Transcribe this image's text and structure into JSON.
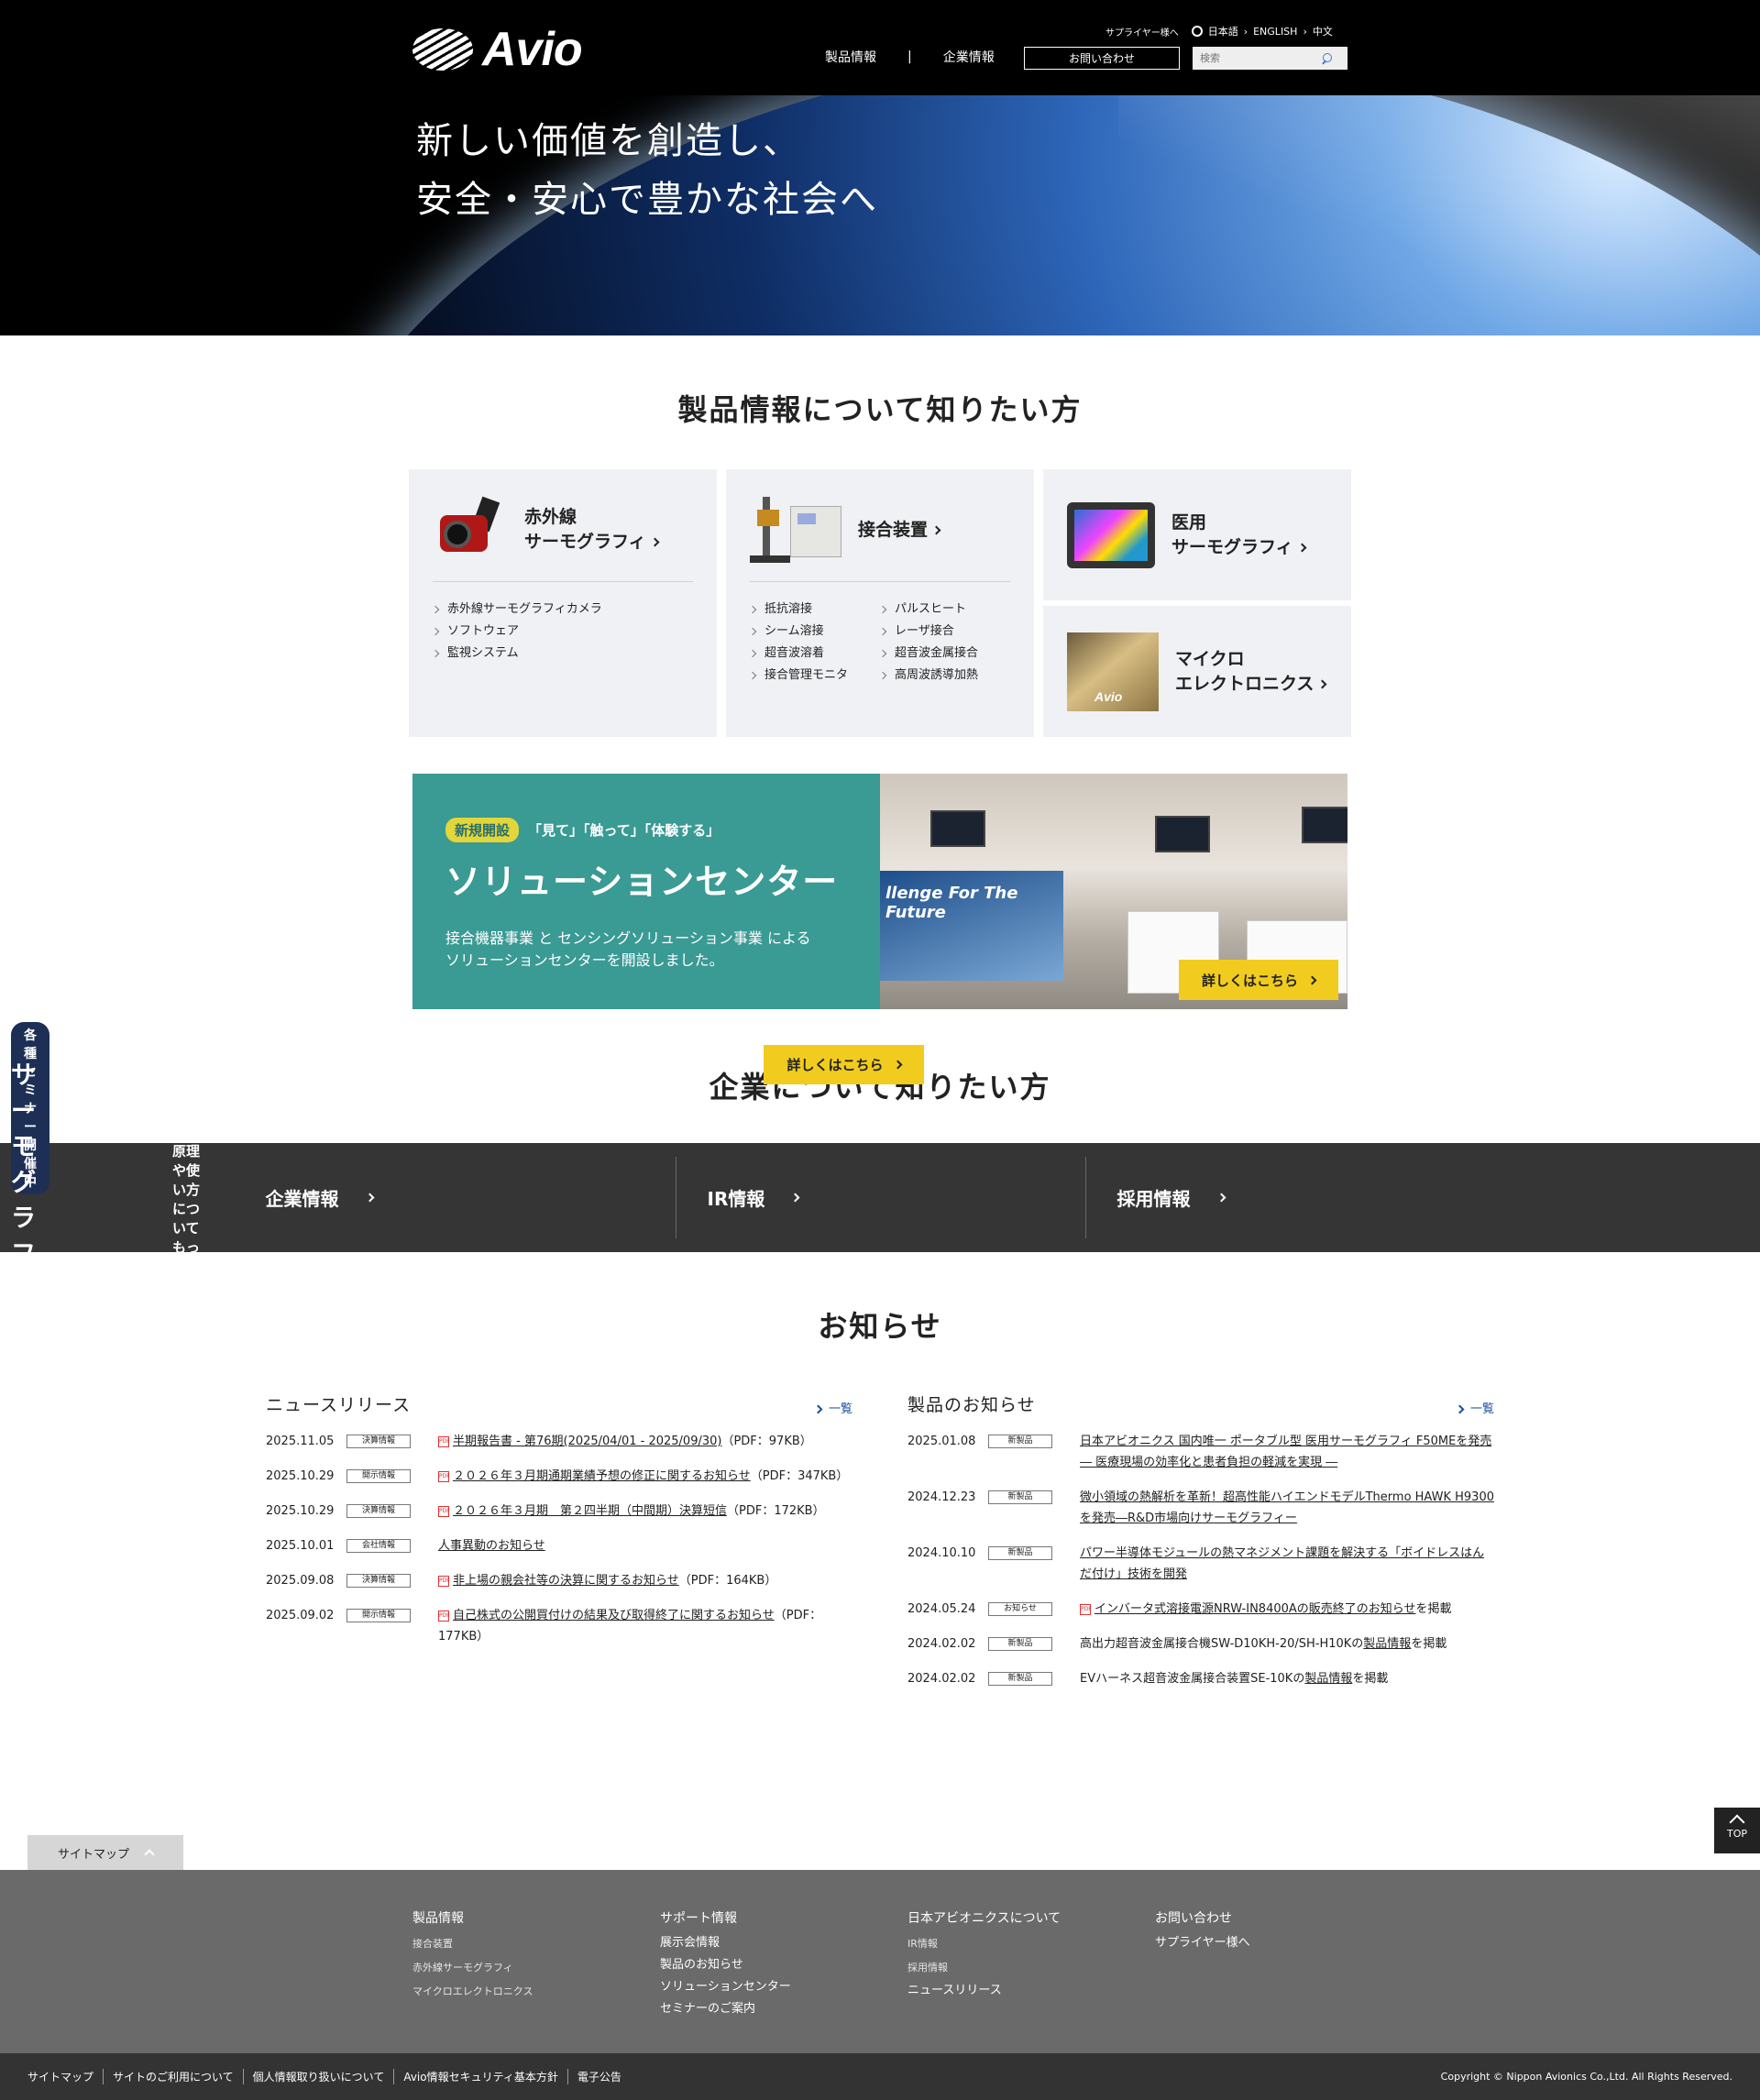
{
  "header": {
    "logo_text": "Avio",
    "supplier": "サプライヤー様へ",
    "languages": [
      "日本語",
      "ENGLISH",
      "中文"
    ],
    "nav": [
      "製品情報",
      "企業情報"
    ],
    "contact": "お問い合わせ",
    "search_placeholder": "検索"
  },
  "hero": {
    "line1": "新しい価値を創造し、",
    "line2": "安全・安心で豊かな社会へ"
  },
  "products": {
    "title": "製品情報について知りたい方",
    "infrared": {
      "title1": "赤外線",
      "title2": "サーモグラフィ",
      "items": [
        "赤外線サーモグラフィカメラ",
        "ソフトウェア",
        "監視システム"
      ]
    },
    "joining": {
      "title": "接合装置",
      "items": [
        "抵抗溶接",
        "パルスヒート",
        "シーム溶接",
        "レーザ接合",
        "超音波溶着",
        "超音波金属接合",
        "接合管理モニタ",
        "高周波誘導加熱"
      ]
    },
    "medical": {
      "title1": "医用",
      "title2": "サーモグラフィ"
    },
    "micro": {
      "title1": "マイクロ",
      "title2": "エレクトロニクス",
      "img_label": "Avio"
    }
  },
  "banner1": {
    "tag": "新規開設",
    "sub": "「見て」「触って」「体験する」",
    "title": "ソリューションセンター",
    "text1": "接合機器事業 と センシングソリューション事業 による",
    "text2": "ソリューションセンターを開設しました。",
    "poster": "llenge For The Future",
    "button": "詳しくはこちら"
  },
  "banner2": {
    "tag": "各種セミナー開催中",
    "sub": "どんな仕組みなんだろう？原理や使い方についてもっと知りたい！",
    "title": "サーモグラフィや接合機器の疑問や課題を解決するセミナー",
    "button": "詳しくはこちら"
  },
  "corporate": {
    "title": "企業について知りたい方",
    "items": [
      "企業情報",
      "IR情報",
      "採用情報"
    ]
  },
  "news": {
    "title": "お知らせ",
    "more": "一覧",
    "releases": {
      "title": "ニュースリリース",
      "rows": [
        {
          "date": "2025.11.05",
          "cat": "決算情報",
          "pdf": true,
          "link": "半期報告書 - 第76期(2025/04/01 - 2025/09/30)",
          "tail": "（PDF：97KB）"
        },
        {
          "date": "2025.10.29",
          "cat": "開示情報",
          "pdf": true,
          "link": "２０２６年３月期通期業績予想の修正に関するお知らせ",
          "tail": "（PDF：347KB）"
        },
        {
          "date": "2025.10.29",
          "cat": "決算情報",
          "pdf": true,
          "link": "２０２６年３月期　第２四半期（中間期）決算短信",
          "tail": "（PDF：172KB）"
        },
        {
          "date": "2025.10.01",
          "cat": "会社情報",
          "pdf": false,
          "link": "人事異動のお知らせ",
          "tail": ""
        },
        {
          "date": "2025.09.08",
          "cat": "決算情報",
          "pdf": true,
          "link": "非上場の親会社等の決算に関するお知らせ",
          "tail": "（PDF：164KB）"
        },
        {
          "date": "2025.09.02",
          "cat": "開示情報",
          "pdf": true,
          "link": "自己株式の公開買付けの結果及び取得終了に関するお知らせ",
          "tail": "（PDF：177KB）"
        }
      ]
    },
    "products": {
      "title": "製品のお知らせ",
      "rows": [
        {
          "date": "2025.01.08",
          "cat": "新製品",
          "pdf": false,
          "link": "日本アビオニクス 国内唯一 ポータブル型 医用サーモグラフィ F50MEを発売 ― 医療現場の効率化と患者負担の軽減を実現 ―",
          "tail": ""
        },
        {
          "date": "2024.12.23",
          "cat": "新製品",
          "pdf": false,
          "link": "微小領域の熱解析を革新！超高性能ハイエンドモデルThermo HAWK H9300を発売―R&D市場向けサーモグラフィー",
          "tail": ""
        },
        {
          "date": "2024.10.10",
          "cat": "新製品",
          "pdf": false,
          "link": "パワー半導体モジュールの熱マネジメント課題を解決する「ボイドレスはんだ付け」技術を開発",
          "tail": ""
        },
        {
          "date": "2024.05.24",
          "cat": "お知らせ",
          "pdf": true,
          "link": "インバータ式溶接電源NRW-IN8400Aの販売終了のお知らせ",
          "tail": "を掲載"
        },
        {
          "date": "2024.02.02",
          "cat": "新製品",
          "pdf": false,
          "pre": "高出力超音波金属接合機SW-D10KH-20/SH-H10Kの",
          "link": "製品情報",
          "tail": "を掲載"
        },
        {
          "date": "2024.02.02",
          "cat": "新製品",
          "pdf": false,
          "pre": "EVハーネス超音波金属接合装置SE-10Kの",
          "link": "製品情報",
          "tail": "を掲載"
        }
      ]
    }
  },
  "footer": {
    "top": "TOP",
    "sitemap": "サイトマップ",
    "col1": {
      "head": "製品情報",
      "items": [
        "接合装置",
        "赤外線サーモグラフィ",
        "マイクロエレクトロニクス"
      ]
    },
    "col2": {
      "head": "サポート情報",
      "items": [
        "展示会情報",
        "製品のお知らせ",
        "ソリューションセンター",
        "セミナーのご案内"
      ]
    },
    "col3": {
      "head": "日本アビオニクスについて",
      "items": [
        "IR情報",
        "採用情報"
      ],
      "item_md": "ニュースリリース"
    },
    "col4": {
      "head": "お問い合わせ",
      "item_md": "サプライヤー様へ"
    },
    "links": [
      "サイトマップ",
      "サイトのご利用について",
      "個人情報取り扱いについて",
      "Avio情報セキュリティ基本方針",
      "電子公告"
    ],
    "copyright": "Copyright © Nippon Avionics Co.,Ltd. All Rights Reserved."
  }
}
